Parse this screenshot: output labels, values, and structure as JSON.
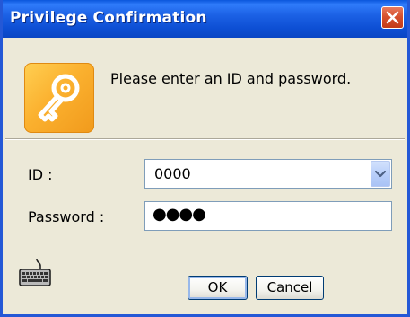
{
  "window": {
    "title": "Privilege Confirmation"
  },
  "dialog": {
    "message": "Please enter an ID and password.",
    "icon": "key-icon"
  },
  "form": {
    "id_label": "ID :",
    "id_value": "0000",
    "password_label": "Password :",
    "password_value": "●●●●"
  },
  "buttons": {
    "ok_label": "OK",
    "cancel_label": "Cancel"
  },
  "colors": {
    "titlebar": "#0d4fd4",
    "close_button": "#d6502e",
    "key_tile": "#fbb12f",
    "dialog_background": "#ece9d8"
  }
}
